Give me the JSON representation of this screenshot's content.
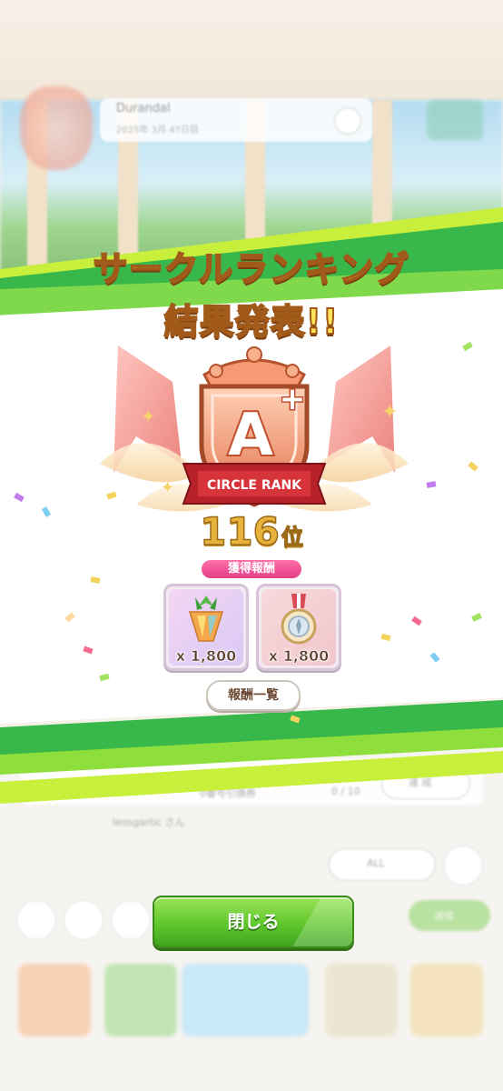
{
  "background": {
    "circle_name": "Durandal",
    "circle_subtitle": "2025年 3月 47日目",
    "list_row_status": "0 / 10",
    "list_row_label": "0番号引換券",
    "list_row_button": "達 成",
    "member_text": "leosgartic さん",
    "filter_label": "ALL",
    "search_button": "送信"
  },
  "title": {
    "line1": "サークルランキング",
    "line2": "結果発表!!"
  },
  "emblem": {
    "rank": "A",
    "modifier": "+",
    "ribbon_text": "CIRCLE RANK"
  },
  "rank_result": {
    "number": "116",
    "unit": "位"
  },
  "rewards": {
    "label": "獲得報酬",
    "items": [
      {
        "icon": "carrot-crystal-icon",
        "quantity": "x 1,800"
      },
      {
        "icon": "circle-medal-icon",
        "quantity": "x 1,800"
      }
    ]
  },
  "buttons": {
    "reward_list": "報酬一覧",
    "close": "閉じる"
  },
  "colors": {
    "stripe_green": "#5fcf3a",
    "stripe_lime": "#c8ef3c",
    "title_yellow": "#ffe45a",
    "reward_label_pink": "#e33f86",
    "close_green": "#5fc72c"
  }
}
